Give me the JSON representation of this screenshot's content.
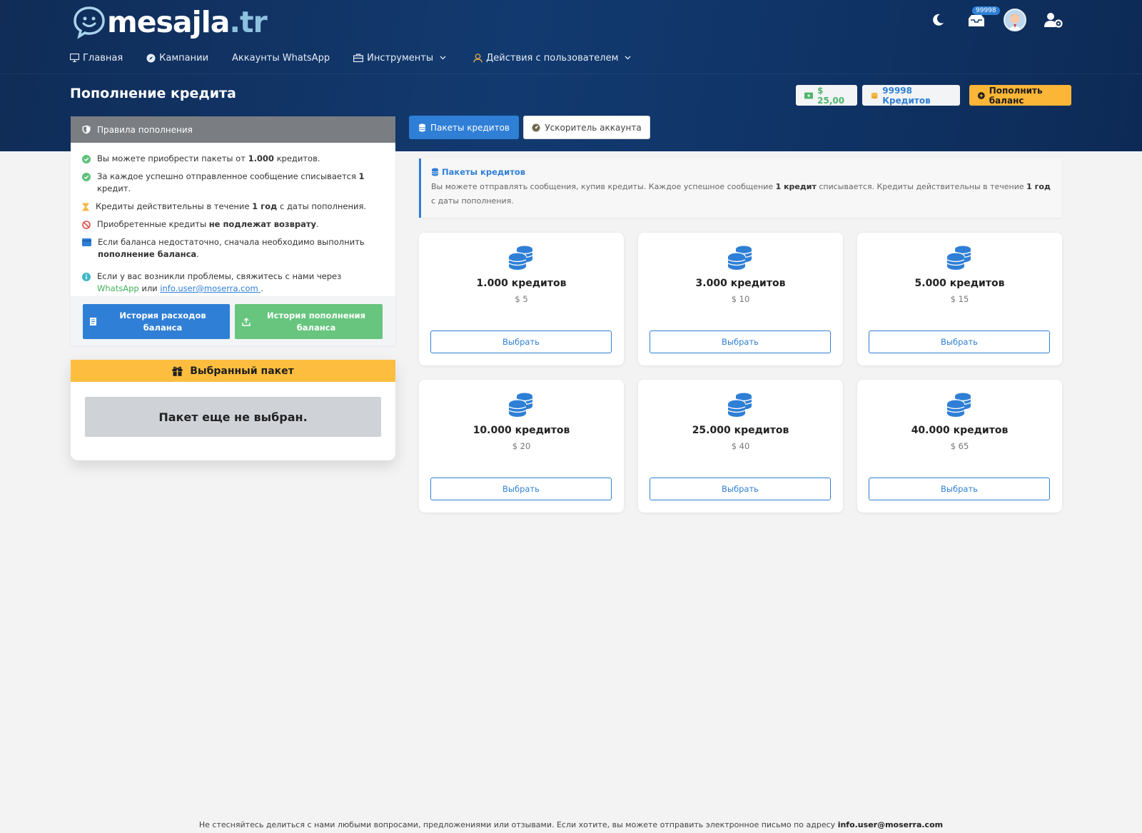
{
  "brand": {
    "name": "mesajla",
    "tld": ".tr"
  },
  "header": {
    "notifications_count": "99998"
  },
  "nav": {
    "items": [
      {
        "label": "Главная",
        "icon": "monitor-icon"
      },
      {
        "label": "Кампании",
        "icon": "compass-icon"
      },
      {
        "label": "Аккаунты WhatsApp",
        "icon": ""
      },
      {
        "label": "Инструменты",
        "icon": "toolbox-icon",
        "dropdown": true
      },
      {
        "label": "Действия с пользователем",
        "icon": "user-icon",
        "dropdown": true
      }
    ]
  },
  "page": {
    "title": "Пополнение кредита"
  },
  "balance": {
    "money": "$ 25,00",
    "credits": "99998 Кредитов",
    "topup_label": "Пополнить баланс"
  },
  "rules": {
    "title": "Правила пополнения",
    "r1_pre": "Вы можете приобрести пакеты от ",
    "r1_bold": "1.000",
    "r1_post": " кредитов.",
    "r2_pre": "За каждое успешно отправленное сообщение списывается ",
    "r2_bold": "1",
    "r2_post": " кредит.",
    "r3_pre": "Кредиты действительны в течение ",
    "r3_bold": "1 год",
    "r3_post": " с даты пополнения.",
    "r4_pre": "Приобретенные кредиты ",
    "r4_bold": "не подлежат возврату",
    "r4_post": ".",
    "r5_pre": "Если баланса недостаточно, сначала необходимо выполнить ",
    "r5_bold": "пополнение баланса",
    "r5_post": ".",
    "r6_pre": "Если у вас возникли проблемы, свяжитесь с нами через ",
    "r6_whatsapp": "WhatsApp",
    "r6_mid": " или ",
    "r6_email": "info.user@moserra.com ",
    "r6_post": "."
  },
  "history": {
    "spend_label": "История расходов баланса",
    "refill_label": "История пополнения баланса"
  },
  "selected": {
    "title": "Выбранный пакет",
    "empty_text": "Пакет еще не выбран."
  },
  "tabs": [
    {
      "label": "Пакеты кредитов",
      "active": true
    },
    {
      "label": "Ускоритель аккаунта",
      "active": false
    }
  ],
  "info": {
    "title": "Пакеты кредитов",
    "t1": "Вы можете отправлять сообщения, купив кредиты. Каждое успешное сообщение ",
    "t1_bold": "1 кредит",
    "t2": " списывается. Кредиты действительны в течение ",
    "t2_bold": "1 год",
    "t3": " с даты пополнения."
  },
  "packages": [
    {
      "title": "1.000 кредитов",
      "price": "$ 5",
      "button": "Выбрать"
    },
    {
      "title": "3.000 кредитов",
      "price": "$ 10",
      "button": "Выбрать"
    },
    {
      "title": "5.000 кредитов",
      "price": "$ 15",
      "button": "Выбрать"
    },
    {
      "title": "10.000 кредитов",
      "price": "$ 20",
      "button": "Выбрать"
    },
    {
      "title": "25.000 кредитов",
      "price": "$ 40",
      "button": "Выбрать"
    },
    {
      "title": "40.000 кредитов",
      "price": "$ 65",
      "button": "Выбрать"
    }
  ],
  "footer": {
    "text": "Не стесняйтесь делиться с нами любыми вопросами, предложениями или отзывами. Если хотите, вы можете отправить электронное письмо по адресу ",
    "email": "info.user@moserra.com"
  },
  "colors": {
    "primary": "#2f7fd6",
    "success": "#67c57e",
    "warning": "#fdbe3f",
    "hero": "#123a70"
  }
}
